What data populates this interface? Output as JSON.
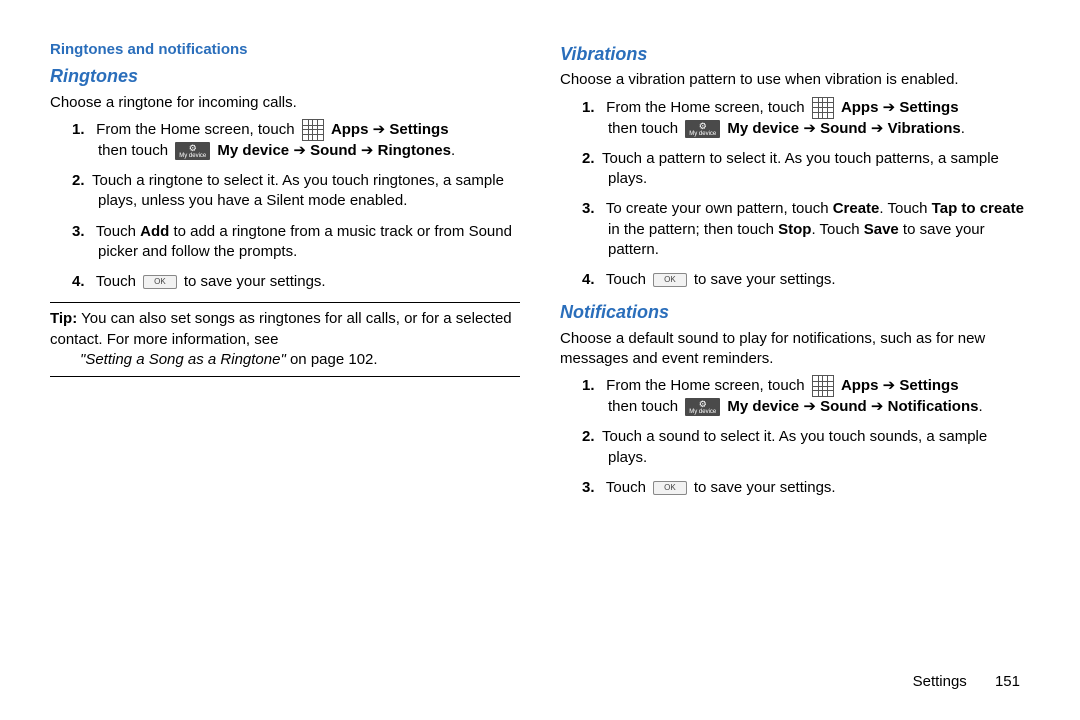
{
  "left": {
    "section_title": "Ringtones and notifications",
    "sub1": "Ringtones",
    "intro1": "Choose a ringtone for incoming calls.",
    "step1_a": "From the Home screen, touch ",
    "apps_label": "Apps",
    "settings_label": "Settings",
    "step1_b": "then touch ",
    "mydevice_label": "My device",
    "sound_label": "Sound",
    "path_end1": "Ringtones",
    "step2": "Touch a ringtone to select it. As you touch ringtones, a sample plays, unless you have a Silent mode enabled.",
    "step3_a": "Touch ",
    "step3_add": "Add",
    "step3_b": " to add a ringtone from a music track or from Sound picker and follow the prompts.",
    "step4_a": "Touch ",
    "ok_label": "OK",
    "step4_b": " to save your settings.",
    "tip_label": "Tip:",
    "tip_a": " You can also set songs as ringtones for all calls, or for a selected contact. For more information, see ",
    "tip_ref": "\"Setting a Song as a Ringtone\"",
    "tip_b": " on page 102."
  },
  "right": {
    "sub2": "Vibrations",
    "intro2": "Choose a vibration pattern to use when vibration is enabled.",
    "v_step1_a": "From the Home screen, touch ",
    "v_step1_b": "then touch ",
    "v_path_end": "Vibrations",
    "v_step2": "Touch a pattern to select it. As you touch patterns, a sample plays.",
    "v_step3_a": "To create your own pattern, touch ",
    "v_create": "Create",
    "v_step3_b": ". Touch ",
    "v_tap": "Tap to create",
    "v_step3_c": " in the pattern; then touch ",
    "v_stop": "Stop",
    "v_step3_d": ". Touch ",
    "v_save": "Save",
    "v_step3_e": " to save your pattern.",
    "v_step4_a": "Touch ",
    "v_step4_b": " to save your settings.",
    "sub3": "Notifications",
    "intro3": "Choose a default sound to play for notifications, such as for new messages and event reminders.",
    "n_step1_a": "From the Home screen, touch ",
    "n_step1_b": "then touch ",
    "n_path_end": "Notifications",
    "n_step2": "Touch a sound to select it. As you touch sounds, a sample plays.",
    "n_step3_a": "Touch ",
    "n_step3_b": " to save your settings."
  },
  "footer": {
    "label": "Settings",
    "page": "151"
  },
  "icons": {
    "mydev": "My device",
    "ok": "OK"
  }
}
